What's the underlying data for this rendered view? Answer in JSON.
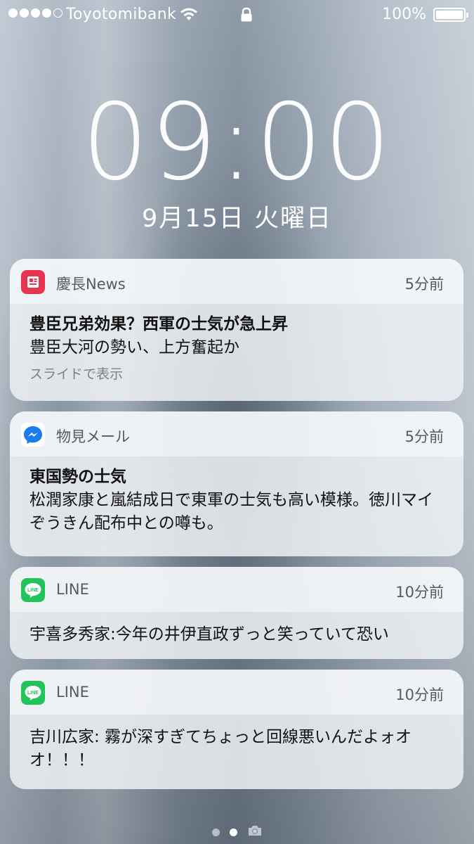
{
  "status_bar": {
    "signal_bars_filled": 4,
    "signal_bars_total": 5,
    "carrier": "Toyotomibank",
    "battery_percent": "100%"
  },
  "lock_screen": {
    "time": "09:00",
    "date": "9月15日 火曜日"
  },
  "notifications": [
    {
      "app": "慶長News",
      "icon": "news-icon",
      "time_ago": "5分前",
      "title": "豊臣兄弟効果？西軍の士気が急上昇",
      "body": "豊臣大河の勢い、上方奮起か",
      "hint": "スライドで表示"
    },
    {
      "app": "物見メール",
      "icon": "messenger-icon",
      "time_ago": "5分前",
      "title": "東国勢の士気",
      "body": "松潤家康と嵐結成日で東軍の士気も高い模様。徳川マイぞうきん配布中との噂も。"
    },
    {
      "app": "LINE",
      "icon": "line-icon",
      "time_ago": "10分前",
      "body": "宇喜多秀家:今年の井伊直政ずっと笑っていて恐い"
    },
    {
      "app": "LINE",
      "icon": "line-icon",
      "time_ago": "10分前",
      "body": "吉川広家: 霧が深すぎてちょっと回線悪いんだよォオオ！！！"
    }
  ],
  "page_indicator": {
    "pages": 2,
    "current_page": 2,
    "camera_icon": "camera-icon"
  },
  "colors": {
    "news_icon": "#e8344e",
    "messenger_blue": "#1a7cf0",
    "line_green": "#22c35a"
  }
}
